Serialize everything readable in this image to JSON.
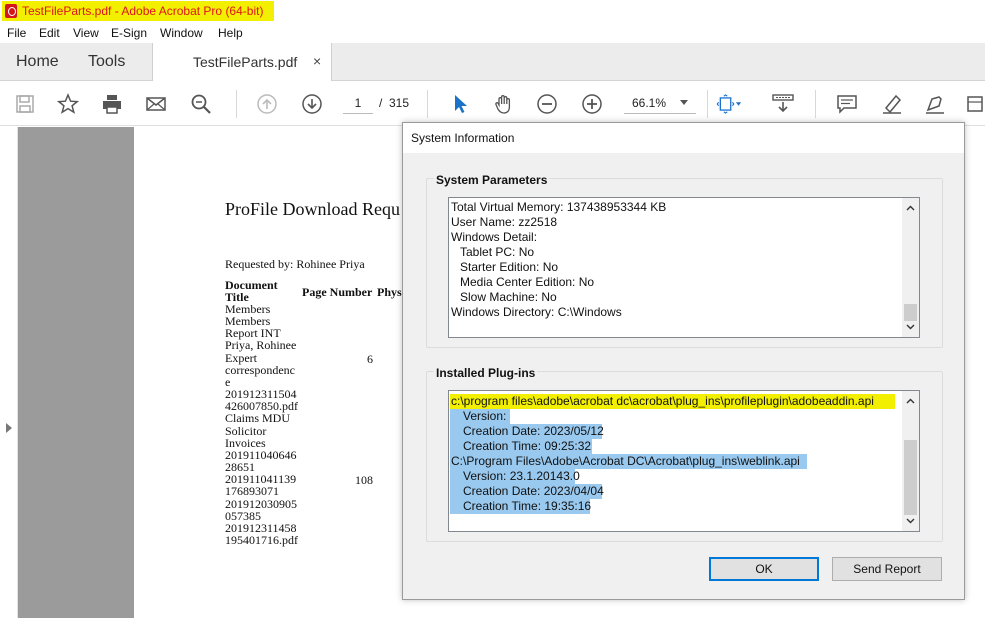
{
  "window": {
    "title": "TestFileParts.pdf - Adobe Acrobat Pro (64-bit)"
  },
  "menu": [
    "File",
    "Edit",
    "View",
    "E-Sign",
    "Window",
    "Help"
  ],
  "tabs": {
    "home": "Home",
    "tools": "Tools",
    "document": "TestFileParts.pdf",
    "close": "×"
  },
  "toolbar": {
    "page_current": "1",
    "page_sep": "/",
    "page_total": "315",
    "zoom": "66.1%"
  },
  "document": {
    "title": "ProFile Download Requ",
    "requested_by": "Requested by: Rohinee Priya",
    "headers": {
      "doc_title_1": "Document",
      "doc_title_2": "Title",
      "page_number": "Page Number",
      "phys": "Phys"
    },
    "column_lines": [
      "Members",
      "Members",
      "Report INT",
      "Priya, Rohinee",
      "Expert",
      "correspondenc",
      "e",
      "201912311504",
      "426007850.pdf",
      "Claims MDU",
      "Solicitor",
      "Invoices",
      "201911040646",
      "28651",
      "201911041139",
      "176893071",
      "201912030905",
      "057385",
      "201912311458",
      "195401716.pdf"
    ],
    "page_number_values": [
      "6",
      "108"
    ]
  },
  "dialog": {
    "title": "System Information",
    "system_parameters": {
      "label": "System Parameters",
      "lines": [
        "Total Virtual Memory: 137438953344 KB",
        "User Name: zz2518",
        "Windows Detail:",
        "Tablet PC: No",
        "Starter Edition: No",
        "Media Center Edition: No",
        "Slow Machine: No",
        "Windows Directory: C:\\Windows"
      ]
    },
    "installed_plugins": {
      "label": "Installed Plug-ins",
      "lines": [
        "c:\\program files\\adobe\\acrobat dc\\acrobat\\plug_ins\\profileplugin\\adobeaddin.api",
        "Version:",
        "Creation Date: 2023/05/12",
        "Creation Time: 09:25:32",
        "C:\\Program Files\\Adobe\\Acrobat DC\\Acrobat\\plug_ins\\weblink.api",
        "Version: 23.1.20143.0",
        "Creation Date: 2023/04/04",
        "Creation Time: 19:35:16"
      ]
    },
    "ok_label": "OK",
    "send_report_label": "Send Report"
  },
  "colors": {
    "title_highlight": "#f2f000",
    "selection": "#99c9ef",
    "accent": "#0078d7",
    "pdf_red": "#e0141e"
  }
}
